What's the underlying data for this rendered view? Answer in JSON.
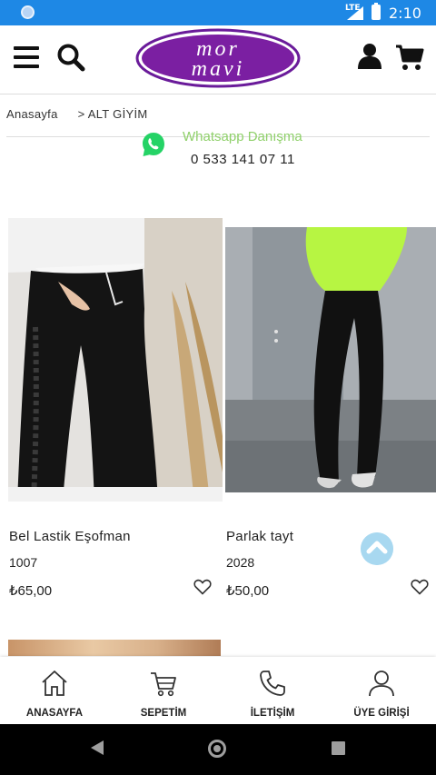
{
  "status_bar": {
    "network": "LTE",
    "time": "2:10"
  },
  "header": {
    "logo_line1": "mor",
    "logo_line2": "mavi",
    "colors": {
      "logo_purple": "#7b1fa2",
      "logo_border": "#4a148c"
    }
  },
  "breadcrumb": {
    "home": "Anasayfa",
    "separator": ">",
    "current": "ALT GİYİM"
  },
  "whatsapp": {
    "title": "Whatsapp Danışma",
    "phone": "0 533 141 07 11"
  },
  "products": [
    {
      "name": "Bel Lastik Eşofman",
      "code": "1007",
      "price": "₺65,00"
    },
    {
      "name": "Parlak tayt",
      "code": "2028",
      "price": "₺50,00"
    }
  ],
  "bottom_nav": [
    {
      "label": "ANASAYFA",
      "icon": "home-icon"
    },
    {
      "label": "SEPETİM",
      "icon": "cart-icon"
    },
    {
      "label": "İLETİŞİM",
      "icon": "phone-icon"
    },
    {
      "label": "ÜYE GİRİŞİ",
      "icon": "user-icon"
    }
  ]
}
